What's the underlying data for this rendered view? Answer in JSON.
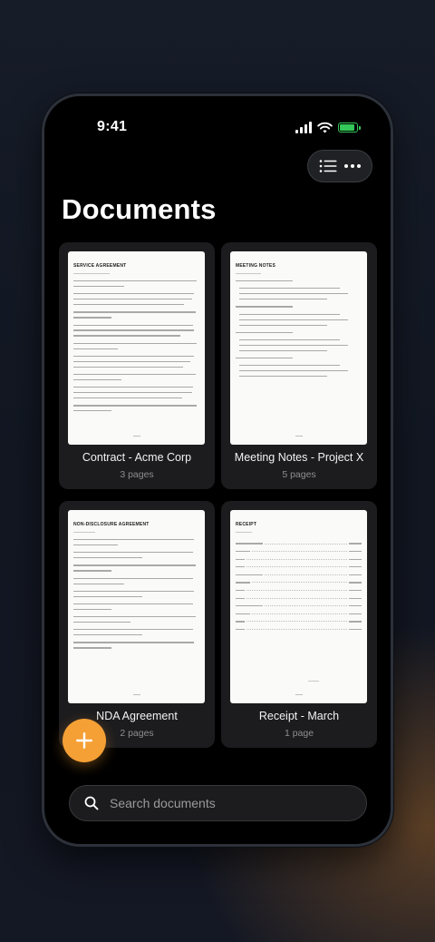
{
  "status": {
    "time": "9:41"
  },
  "header": {
    "title": "Documents"
  },
  "toolbar": {
    "list_icon": "list-icon",
    "more_icon": "more-icon"
  },
  "documents": [
    {
      "name": "Contract - Acme Corp",
      "pages": "3 pages",
      "preview_title": "SERVICE AGREEMENT",
      "type": "text"
    },
    {
      "name": "Meeting Notes - Project X",
      "pages": "5 pages",
      "preview_title": "MEETING NOTES",
      "type": "notes"
    },
    {
      "name": "NDA Agreement",
      "pages": "2 pages",
      "preview_title": "NON-DISCLOSURE AGREEMENT",
      "type": "text"
    },
    {
      "name": "Receipt - March",
      "pages": "1 page",
      "preview_title": "RECEIPT",
      "type": "receipt"
    }
  ],
  "fab": {
    "icon": "plus-icon"
  },
  "search": {
    "placeholder": "Search documents",
    "value": ""
  },
  "colors": {
    "accent": "#f5a035",
    "battery": "#34c759",
    "background": "#000000",
    "card": "#1c1c1e"
  }
}
